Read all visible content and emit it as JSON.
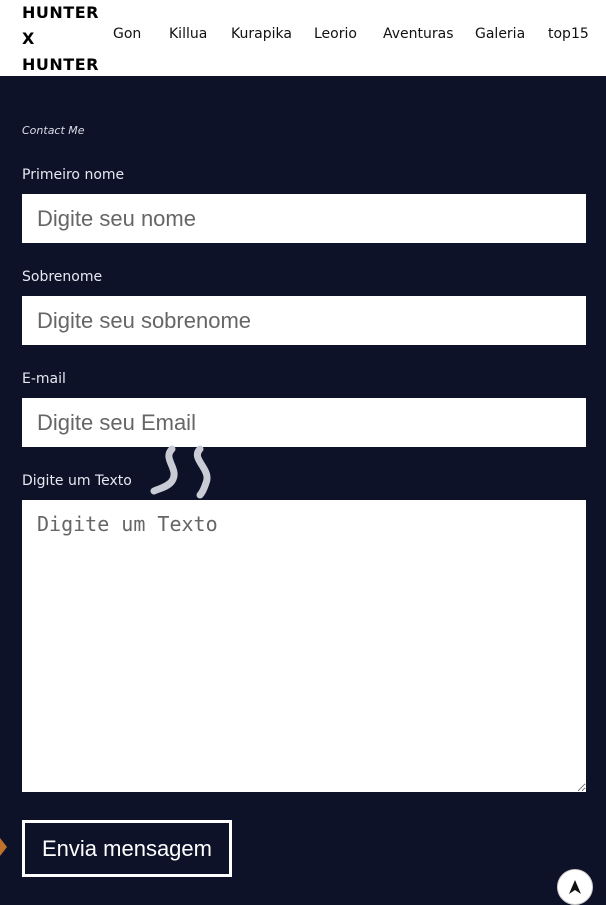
{
  "logo": {
    "lines": [
      "HUNTER",
      "X",
      "HUNTER"
    ]
  },
  "nav": {
    "items": [
      "Gon",
      "Killua",
      "Kurapika",
      "Leorio",
      "Aventuras",
      "Galeria",
      "top15"
    ]
  },
  "contact": {
    "title": "Contact Me",
    "first_name": {
      "label": "Primeiro nome",
      "placeholder": "Digite seu nome"
    },
    "last_name": {
      "label": "Sobrenome",
      "placeholder": "Digite seu sobrenome"
    },
    "email": {
      "label": "E-mail",
      "placeholder": "Digite seu Email"
    },
    "message": {
      "label": "Digite um Texto",
      "placeholder": "Digite um Texto"
    },
    "submit_label": "Envia mensagem"
  },
  "icons": {
    "scroll_top": "arrow-up-icon",
    "decoration": "quote-swirl-icon",
    "edge_tab": "orange-tab-icon"
  },
  "colors": {
    "background": "#0d1229",
    "header": "#ffffff",
    "accent": "#c0722c"
  }
}
